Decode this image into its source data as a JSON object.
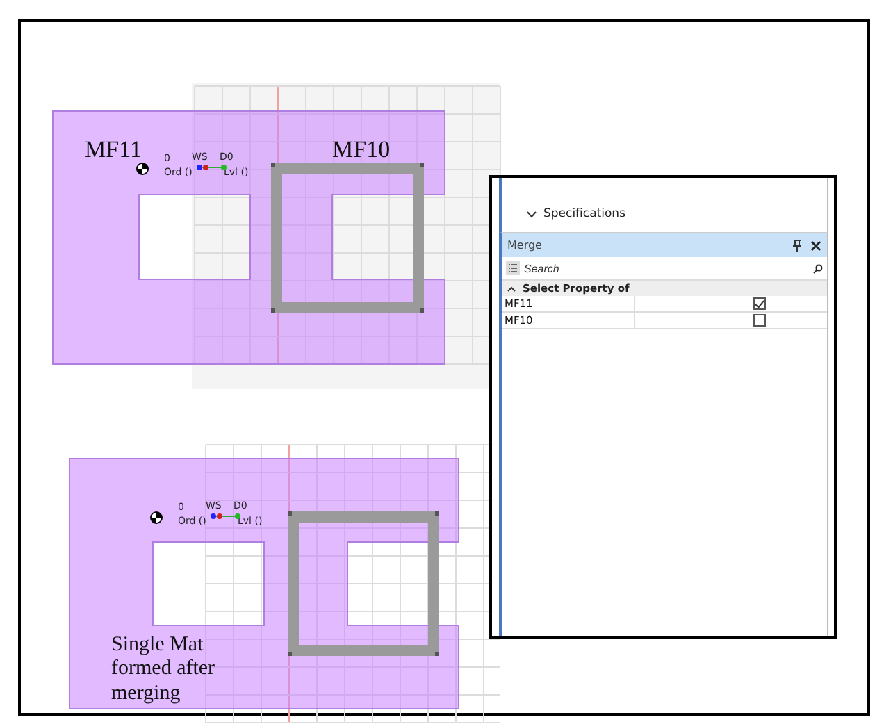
{
  "top_view": {
    "labels": [
      {
        "text": "MF11"
      },
      {
        "text": "MF10"
      }
    ],
    "marker": {
      "zero": "0",
      "ord": "Ord ()",
      "ws": "WS",
      "d": "D0",
      "lvl": "Lvl ()"
    }
  },
  "bottom_view": {
    "marker": {
      "zero": "0",
      "ord": "Ord ()",
      "ws": "WS",
      "d": "D0",
      "lvl": "Lvl ()"
    },
    "caption": "Single Mat formed after merging"
  },
  "panel": {
    "tree_item": {
      "label": "Specifications",
      "expanded": true
    },
    "title": "Merge",
    "search": {
      "placeholder": "Search"
    },
    "group": {
      "label": "Select Property of",
      "expanded": true
    },
    "rows": [
      {
        "name": "MF11",
        "checked": true
      },
      {
        "name": "MF10",
        "checked": false
      }
    ]
  }
}
